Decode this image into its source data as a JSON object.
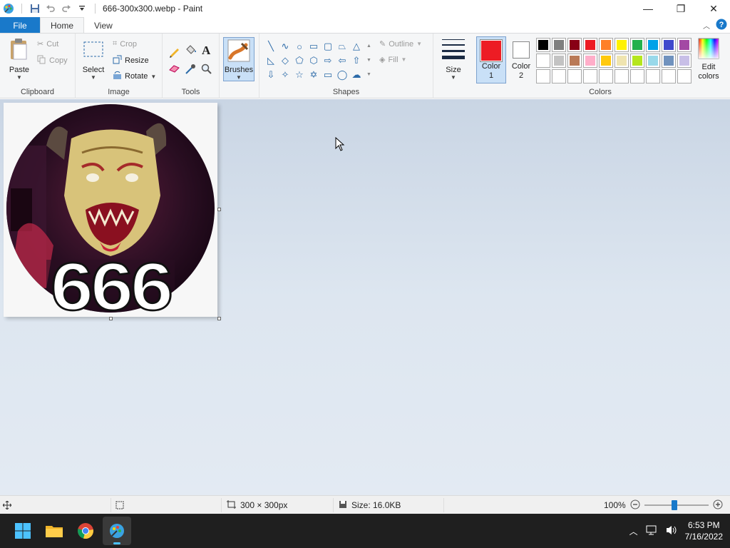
{
  "window": {
    "title": "666-300x300.webp - Paint",
    "minimize_glyph": "—",
    "restore_glyph": "❐",
    "close_glyph": "✕"
  },
  "tabs": {
    "file": "File",
    "home": "Home",
    "view": "View"
  },
  "clipboard": {
    "paste": "Paste",
    "cut": "Cut",
    "copy": "Copy",
    "label": "Clipboard"
  },
  "image": {
    "select": "Select",
    "crop": "Crop",
    "resize": "Resize",
    "rotate": "Rotate",
    "label": "Image"
  },
  "tools": {
    "label": "Tools"
  },
  "brushes": {
    "label": "Brushes"
  },
  "shapes": {
    "outline": "Outline",
    "fill": "Fill",
    "label": "Shapes"
  },
  "size": {
    "label": "Size"
  },
  "colors": {
    "color1_label": "Color 1",
    "color2_label": "Color 2",
    "edit_label": "Edit colors",
    "label": "Colors",
    "color1": "#ed1c24",
    "color2": "#ffffff",
    "palette": [
      "#000000",
      "#7f7f7f",
      "#880015",
      "#ed1c24",
      "#ff7f27",
      "#fff200",
      "#22b14c",
      "#00a2e8",
      "#3f48cc",
      "#a349a4",
      "#ffffff",
      "#c3c3c3",
      "#b97a57",
      "#ffaec9",
      "#ffc90e",
      "#efe4b0",
      "#b5e61d",
      "#99d9ea",
      "#7092be",
      "#c8bfe7",
      "",
      "",
      "",
      "",
      "",
      "",
      "",
      "",
      "",
      ""
    ]
  },
  "canvas_image": {
    "overlay_text": "666"
  },
  "status": {
    "dimensions": "300 × 300px",
    "file_size": "Size: 16.0KB",
    "zoom": "100%"
  },
  "taskbar": {
    "time": "6:53 PM",
    "date": "7/16/2022"
  }
}
